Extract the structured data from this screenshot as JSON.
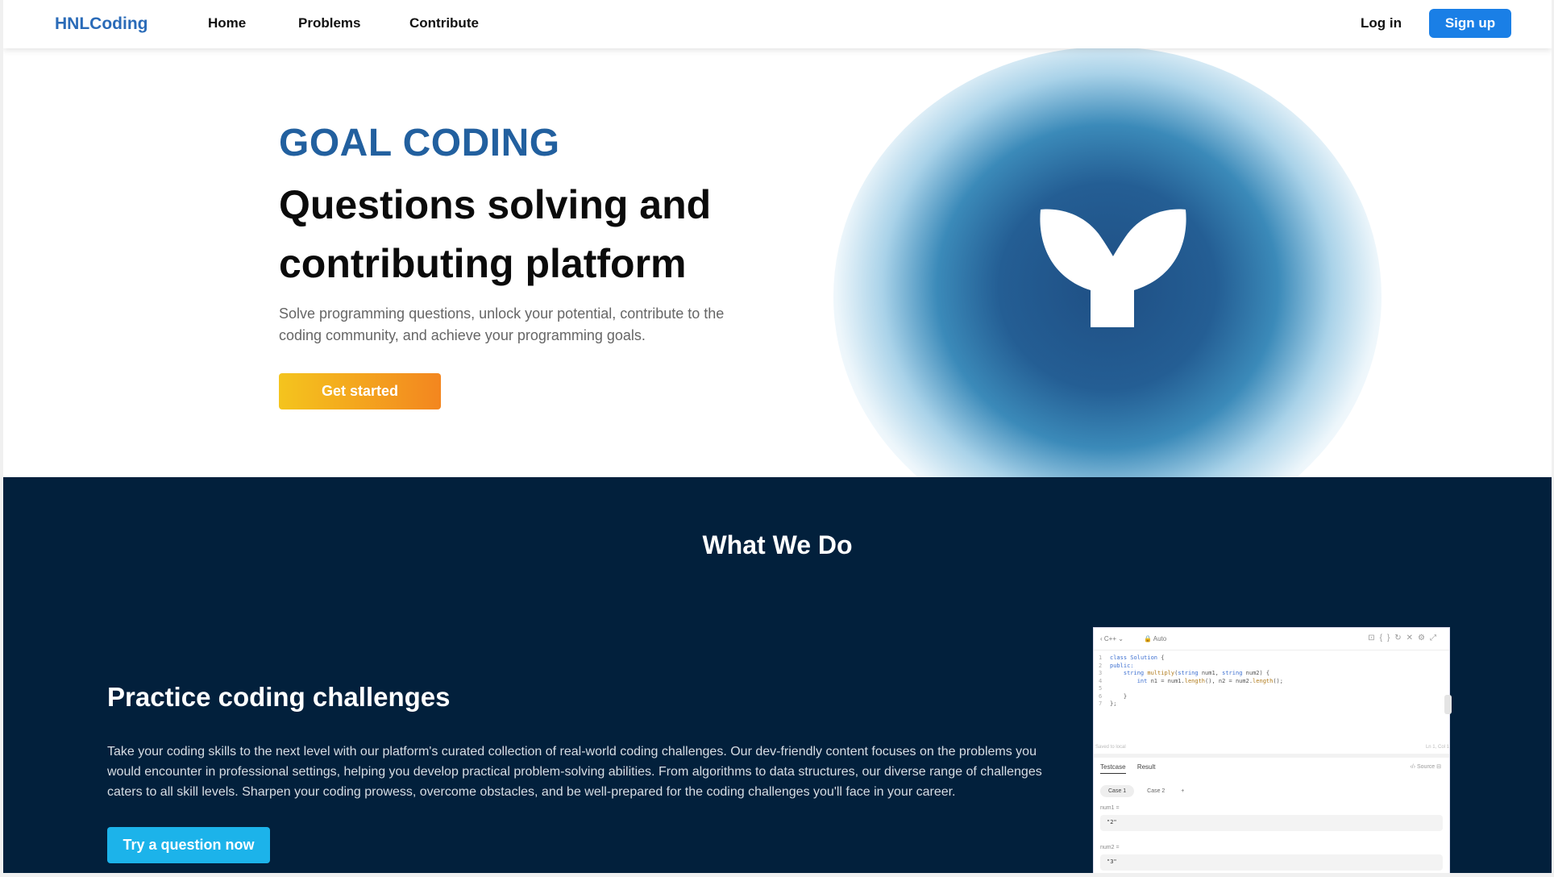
{
  "nav": {
    "brand": "HNLCoding",
    "links": [
      "Home",
      "Problems",
      "Contribute"
    ],
    "login": "Log in",
    "signup": "Sign up"
  },
  "hero": {
    "kicker": "GOAL CODING",
    "title": "Questions solving and contributing platform",
    "description": "Solve programming questions, unlock your potential, contribute to the coding community, and achieve your programming goals.",
    "cta": "Get started"
  },
  "section": {
    "title": "What We Do",
    "feature_title": "Practice coding challenges",
    "feature_description": "Take your coding skills to the next level with our platform's curated collection of real-world coding challenges. Our dev-friendly content focuses on the problems you would encounter in professional settings, helping you develop practical problem-solving abilities. From algorithms to data structures, our diverse range of challenges caters to all skill levels. Sharpen your coding prowess, overcome obstacles, and be well-prepared for the coding challenges you'll face in your career.",
    "feature_cta": "Try a question now"
  },
  "editor": {
    "language": "C++",
    "mode": "Auto",
    "saved": "Saved to local",
    "cursor": "Ln 1, Col 1",
    "tabs": [
      "Testcase",
      "Result"
    ],
    "source": "Source",
    "cases": [
      "Case 1",
      "Case 2"
    ],
    "add_case": "+",
    "params": [
      {
        "label": "num1 =",
        "value": "\"2\""
      },
      {
        "label": "num2 =",
        "value": "\"3\""
      }
    ]
  },
  "colors": {
    "brand": "#2a6bb8",
    "signup": "#1a7fe6",
    "dark_section": "#02203c",
    "cta_gradient_start": "#f4c41e",
    "cta_gradient_end": "#f3861f",
    "try_button": "#1cb3ea"
  }
}
